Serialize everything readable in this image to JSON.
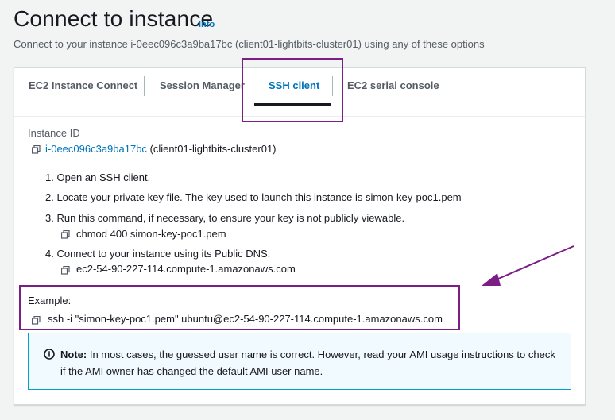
{
  "header": {
    "title": "Connect to instance",
    "info_label": "Info",
    "subtitle": "Connect to your instance i-0eec096c3a9ba17bc (client01-lightbits-cluster01) using any of these options"
  },
  "tabs": [
    {
      "label": "EC2 Instance Connect",
      "active": false
    },
    {
      "label": "Session Manager",
      "active": false
    },
    {
      "label": "SSH client",
      "active": true
    },
    {
      "label": "EC2 serial console",
      "active": false
    }
  ],
  "instance": {
    "label": "Instance ID",
    "id": "i-0eec096c3a9ba17bc",
    "name": "(client01-lightbits-cluster01)"
  },
  "steps": [
    {
      "text": "1. Open an SSH client."
    },
    {
      "text": "2. Locate your private key file. The key used to launch this instance is simon-key-poc1.pem"
    },
    {
      "text": "3. Run this command, if necessary, to ensure your key is not publicly viewable.",
      "command": "chmod 400 simon-key-poc1.pem"
    },
    {
      "text": "4. Connect to your instance using its Public DNS:",
      "command": "ec2-54-90-227-114.compute-1.amazonaws.com"
    }
  ],
  "example": {
    "label": "Example:",
    "command": "ssh -i \"simon-key-poc1.pem\" ubuntu@ec2-54-90-227-114.compute-1.amazonaws.com"
  },
  "note": {
    "bold": "Note:",
    "text": " In most cases, the guessed user name is correct. However, read your AMI usage instructions to check if the AMI owner has changed the default AMI user name."
  },
  "colors": {
    "link": "#0073bb",
    "highlight": "#7b1f86",
    "note_border": "#00a1c9",
    "note_bg": "#f1faff"
  }
}
